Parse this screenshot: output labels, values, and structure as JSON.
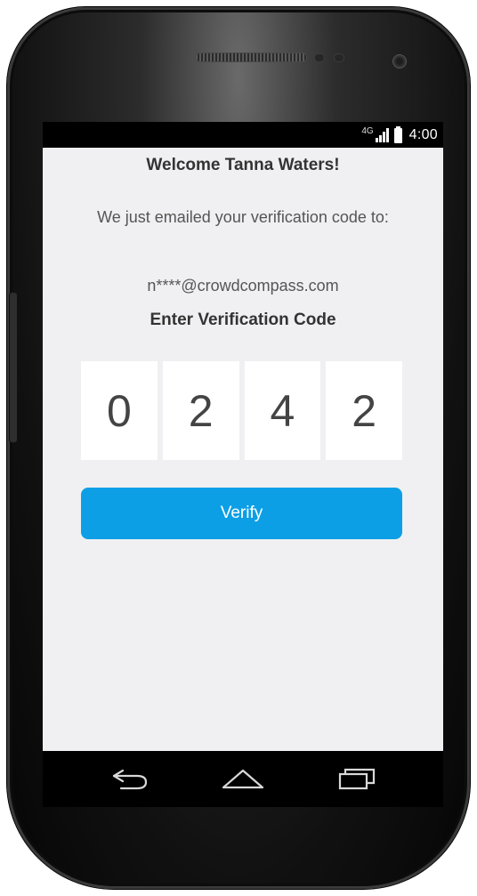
{
  "status_bar": {
    "network_label": "4G",
    "time": "4:00"
  },
  "screen": {
    "title": "Welcome Tanna Waters!",
    "message": "We just emailed your verification code to:",
    "email": "n****@crowdcompass.com",
    "enter_label": "Enter Verification Code",
    "code_digits": [
      "0",
      "2",
      "4",
      "2"
    ],
    "verify_label": "Verify"
  },
  "colors": {
    "accent": "#0c9fe6",
    "background": "#f0f0f2"
  },
  "nav_bar": {
    "icons": [
      "back-icon",
      "home-icon",
      "recent-apps-icon"
    ]
  }
}
